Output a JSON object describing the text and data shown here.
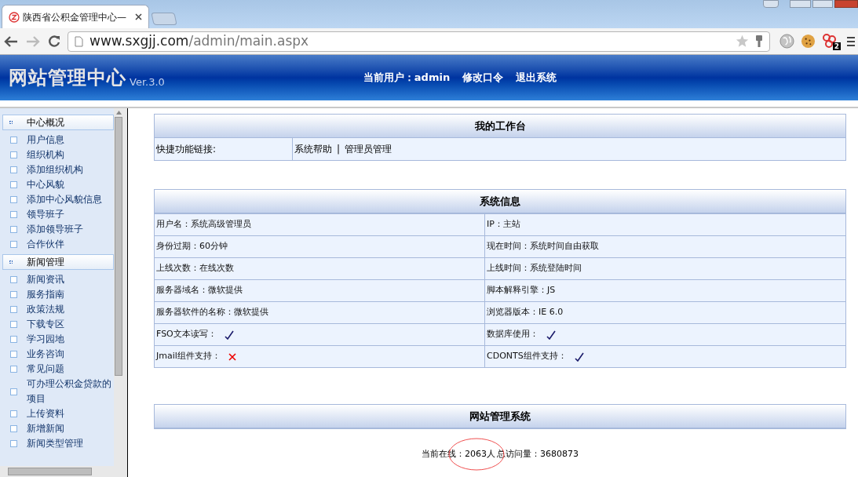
{
  "browser": {
    "tab_title": "陕西省公积金管理中心—",
    "url_host": "www.sxgjj.com",
    "url_path": "/admin/main.aspx",
    "extension_badge": "2"
  },
  "header": {
    "logo": "网站管理中心",
    "version": "Ver.3.0",
    "user_label": "当前用户：",
    "user": "admin",
    "links": [
      "修改口令",
      "退出系统"
    ]
  },
  "sidebar": {
    "groups": [
      {
        "title": "中心概况",
        "items": [
          "用户信息",
          "组织机构",
          "添加组织机构",
          "中心风貌",
          "添加中心风貌信息",
          "领导班子",
          "添加领导班子",
          "合作伙伴"
        ]
      },
      {
        "title": "新闻管理",
        "items": [
          "新闻资讯",
          "服务指南",
          "政策法规",
          "下载专区",
          "学习园地",
          "业务咨询",
          "常见问题",
          "可办理公积金贷款的项目",
          "上传资料",
          "新增新闻",
          "新闻类型管理"
        ]
      }
    ]
  },
  "workbench": {
    "title": "我的工作台",
    "label": "快捷功能链接:",
    "links": [
      "系统帮助",
      "管理员管理"
    ],
    "separator": "|"
  },
  "system_info": {
    "title": "系统信息",
    "rows": [
      [
        {
          "kind": "text",
          "label": "用户名：",
          "value": "系统高级管理员"
        },
        {
          "kind": "text",
          "label": "IP：",
          "value": "主站"
        }
      ],
      [
        {
          "kind": "text",
          "label": "身份过期：",
          "value": "60分钟"
        },
        {
          "kind": "text",
          "label": "现在时间：",
          "value": "系统时间自由获取"
        }
      ],
      [
        {
          "kind": "text",
          "label": "上线次数：",
          "value": "在线次数"
        },
        {
          "kind": "text",
          "label": "上线时间：",
          "value": "系统登陆时间"
        }
      ],
      [
        {
          "kind": "text",
          "label": "服务器域名：",
          "value": "微软提供"
        },
        {
          "kind": "text",
          "label": "脚本解释引擎：",
          "value": "JS"
        }
      ],
      [
        {
          "kind": "text",
          "label": "服务器软件的名称：",
          "value": "微软提供"
        },
        {
          "kind": "text",
          "label": "浏览器版本：",
          "value": "IE 6.0"
        }
      ],
      [
        {
          "kind": "support",
          "label": "FSO文本读写：",
          "supported": true
        },
        {
          "kind": "support",
          "label": "数据库使用：",
          "supported": true
        }
      ],
      [
        {
          "kind": "support",
          "label": "Jmail组件支持：",
          "supported": false
        },
        {
          "kind": "support",
          "label": "CDONTS组件支持：",
          "supported": true
        }
      ]
    ]
  },
  "footer_panel": {
    "title": "网站管理系统",
    "online_label": "当前在线：",
    "online": "2063人",
    "total_label": "总访问量：",
    "total": "3680873"
  }
}
